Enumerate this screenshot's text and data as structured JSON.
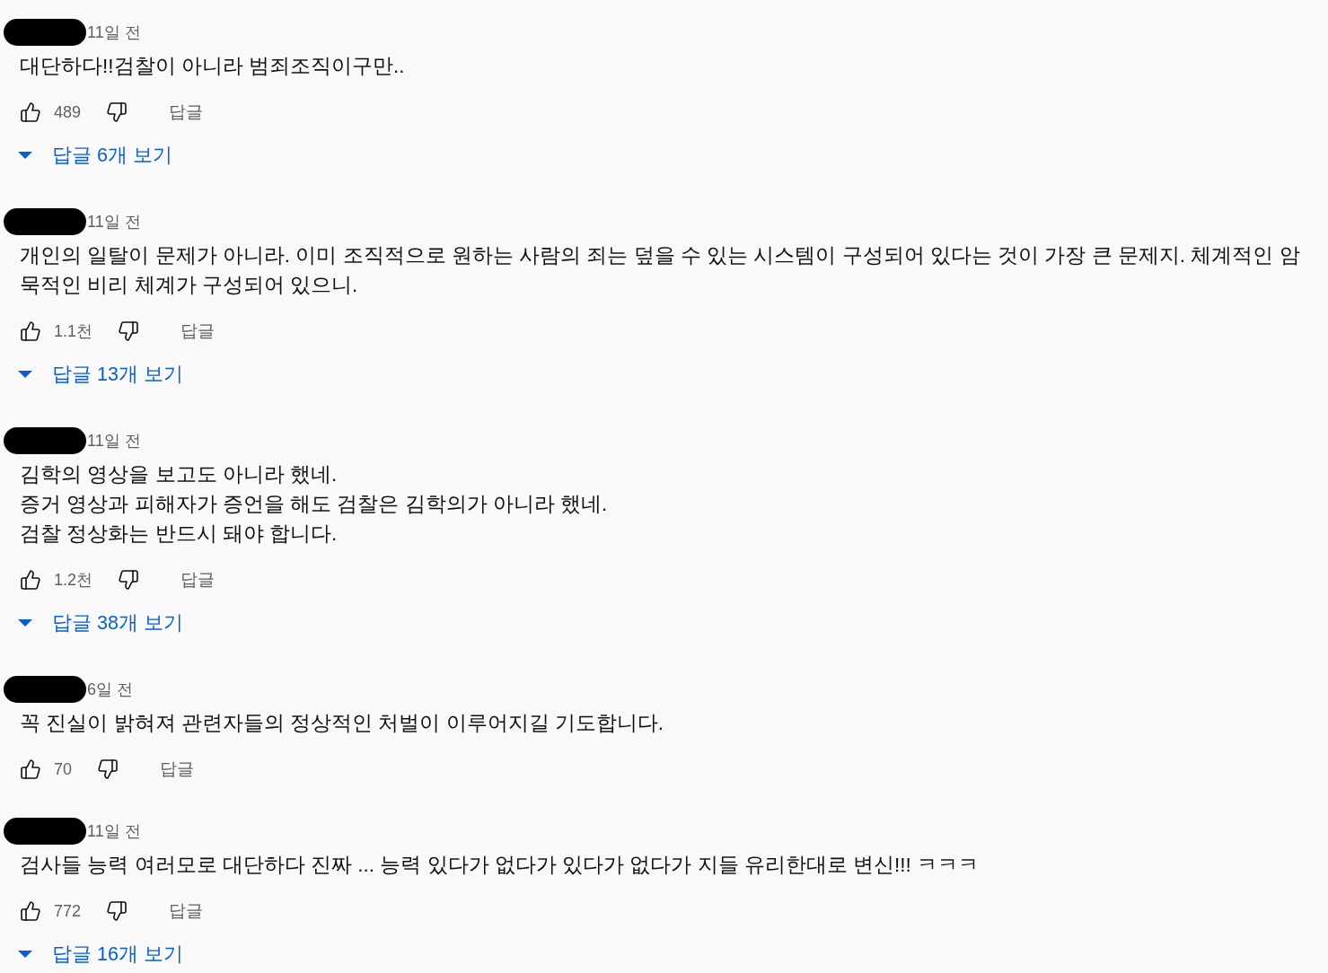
{
  "comments": [
    {
      "time": "11일 전",
      "text": "대단하다!!검찰이 아니라 범죄조직이구만..",
      "likes": "489",
      "reply": "답글",
      "replies": "답글 6개 보기"
    },
    {
      "time": "11일 전",
      "text": "개인의 일탈이 문제가 아니라. 이미 조직적으로 원하는 사람의 죄는 덮을 수 있는 시스템이 구성되어 있다는 것이 가장 큰 문제지. 체계적인 암묵적인 비리 체계가 구성되어 있으니.",
      "likes": "1.1천",
      "reply": "답글",
      "replies": "답글 13개 보기"
    },
    {
      "time": "11일 전",
      "text": "김학의 영상을 보고도 아니라 했네.\n증거 영상과 피해자가 증언을 해도 검찰은 김학의가 아니라 했네.\n검찰 정상화는 반드시 돼야 합니다.",
      "likes": "1.2천",
      "reply": "답글",
      "replies": "답글 38개 보기"
    },
    {
      "time": "6일 전",
      "text": "꼭 진실이 밝혀져 관련자들의 정상적인 처벌이 이루어지길 기도합니다.",
      "likes": "70",
      "reply": "답글"
    },
    {
      "time": "11일 전",
      "text": "검사들 능력 여러모로 대단하다 진짜 ... 능력 있다가 없다가 있다가 없다가 지들 유리한대로 변신!!! ㅋㅋㅋ",
      "likes": "772",
      "reply": "답글",
      "replies": "답글 16개 보기"
    }
  ]
}
